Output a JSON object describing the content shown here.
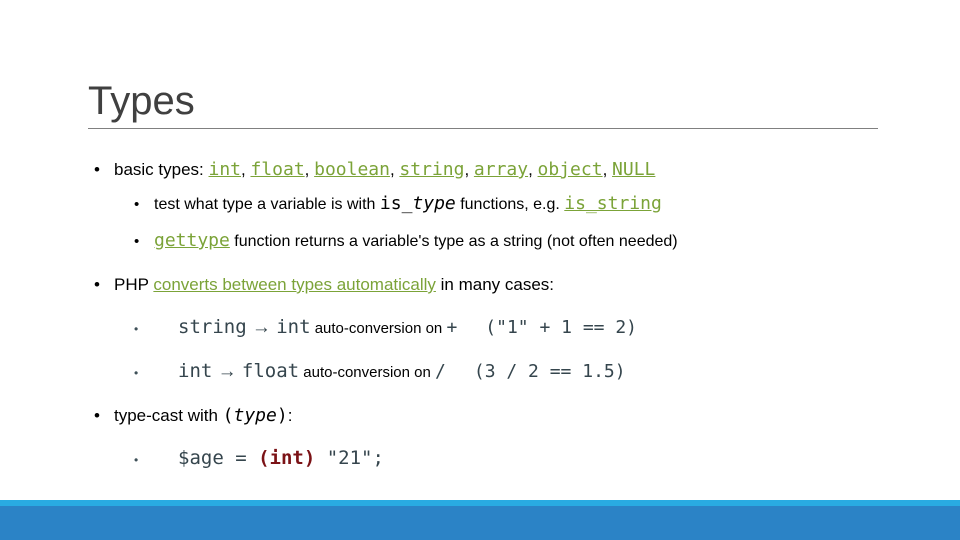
{
  "slide": {
    "title": "Types",
    "bullets": {
      "b1": {
        "marker": "•",
        "lead": "basic types: ",
        "types": [
          "int",
          "float",
          "boolean",
          "string",
          "array",
          "object",
          "NULL"
        ],
        "separator": ", "
      },
      "b2": {
        "marker": "•",
        "lead": "test what type a variable is with ",
        "code_prefix": "is_",
        "code_italic": "type",
        "mid": " functions, e.g. ",
        "code_end": "is_string"
      },
      "b3": {
        "marker": "•",
        "link": " gettype",
        "rest": " function returns a variable's type as a string (not often needed)"
      },
      "b4": {
        "marker": "•",
        "lead": "PHP ",
        "link": "converts between types automatically",
        "rest": " in many cases:"
      },
      "b5": {
        "marker": "•",
        "from": "string",
        "arrow": " → ",
        "to": "int",
        "text": " auto-conversion on ",
        "op": "+",
        "example": "(\"1\" + 1 == 2)"
      },
      "b6": {
        "marker": "•",
        "from": "int",
        "arrow": " → ",
        "to": "float",
        "text": " auto-conversion on ",
        "op": "/",
        "example": "(3 / 2 == 1.5)"
      },
      "b7": {
        "marker": "•",
        "lead": "type-cast with ",
        "paren_open": "(",
        "code_italic": "type",
        "paren_close": ")",
        "trail": ":"
      },
      "b8": {
        "marker": "•",
        "var": "$age ",
        "eq": "= ",
        "cast": "(int)",
        "value": " \"21\";"
      }
    }
  },
  "theme": {
    "accent_green": "#7ba338",
    "accent_slate": "#35454d",
    "accent_maroon": "#7b1216",
    "band_light": "#29abe2",
    "band_main": "#2b83c6",
    "title_color": "#404040",
    "rule_color": "#808080"
  }
}
